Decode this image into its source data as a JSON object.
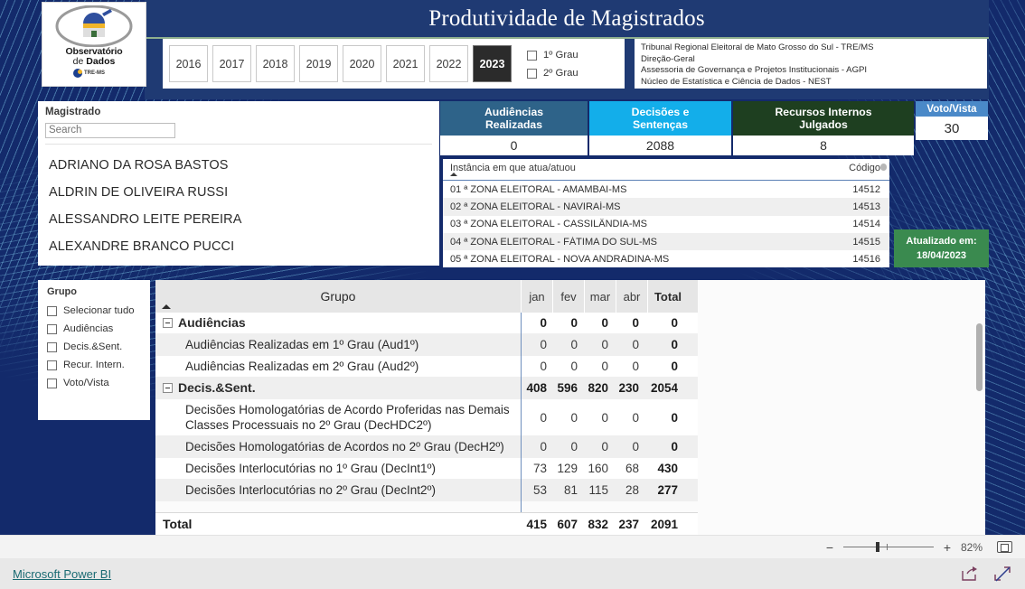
{
  "report": {
    "title": "Produtividade de Magistrados",
    "logo": {
      "name": "observatorio-de-dados-logo",
      "line1": "Observatório",
      "line2_light": "de ",
      "line2_bold": "Dados",
      "badge_text": "TRE-MS"
    },
    "institution_lines": [
      "Tribunal Regional Eleitoral de Mato Grosso do Sul - TRE/MS",
      "Direção-Geral",
      "Assessoria de Governança e Projetos Institucionais - AGPI",
      "Núcleo de Estatística e Ciência de Dados - NEST"
    ],
    "updated": {
      "label": "Atualizado em:",
      "date": "18/04/2023"
    },
    "colors": {
      "canvas_bg": "#132A6B",
      "header_bg": "#1F3A73",
      "kpi_audiencias": "#2E6389",
      "kpi_decisoes": "#13AEEA",
      "kpi_recursos": "#1E3F20",
      "kpi_voto": "#4A89C8",
      "updated_badge": "#3A8A4F",
      "link": "#1A6B73"
    }
  },
  "year_slicer": {
    "name": "year-slicer",
    "years": [
      "2016",
      "2017",
      "2018",
      "2019",
      "2020",
      "2021",
      "2022",
      "2023"
    ],
    "selected": "2023"
  },
  "grau_slicer": {
    "name": "grau-slicer",
    "options": [
      {
        "label": "1º Grau",
        "checked": false
      },
      {
        "label": "2º Grau",
        "checked": false
      }
    ]
  },
  "magistrado_slicer": {
    "title": "Magistrado",
    "search_placeholder": "Search",
    "search_value": "",
    "items": [
      "ADRIANO DA ROSA BASTOS",
      "ALDRIN DE OLIVEIRA RUSSI",
      "ALESSANDRO LEITE PEREIRA",
      "ALEXANDRE BRANCO PUCCI"
    ]
  },
  "kpis": [
    {
      "title_line1": "Audiências",
      "title_line2": "Realizadas",
      "value": "0"
    },
    {
      "title_line1": "Decisões e",
      "title_line2": "Sentenças",
      "value": "2088"
    },
    {
      "title_line1": "Recursos Internos",
      "title_line2": "Julgados",
      "value": "8"
    },
    {
      "title_line1": "Voto/Vista",
      "title_line2": "",
      "value": "30"
    }
  ],
  "instancia_table": {
    "columns": [
      "Instância em que atua/atuou",
      "Código"
    ],
    "rows": [
      {
        "nome": "01 ª ZONA ELEITORAL - AMAMBAI-MS",
        "codigo": "14512"
      },
      {
        "nome": "02 ª ZONA ELEITORAL - NAVIRAÍ-MS",
        "codigo": "14513"
      },
      {
        "nome": "03 ª ZONA ELEITORAL - CASSILÂNDIA-MS",
        "codigo": "14514"
      },
      {
        "nome": "04 ª ZONA ELEITORAL - FÁTIMA DO SUL-MS",
        "codigo": "14515"
      },
      {
        "nome": "05 ª ZONA ELEITORAL - NOVA ANDRADINA-MS",
        "codigo": "14516"
      }
    ]
  },
  "grupo_slicer": {
    "title": "Grupo",
    "options": [
      {
        "label": "Selecionar tudo",
        "checked": false
      },
      {
        "label": "Audiências",
        "checked": false
      },
      {
        "label": "Decis.&Sent.",
        "checked": false
      },
      {
        "label": "Recur. Intern.",
        "checked": false
      },
      {
        "label": "Voto/Vista",
        "checked": false
      }
    ]
  },
  "matrix": {
    "columns": [
      "Grupo",
      "jan",
      "fev",
      "mar",
      "abr",
      "Total"
    ],
    "rows": [
      {
        "label": "Audiências",
        "type": "group",
        "expanded": true,
        "values": [
          "0",
          "0",
          "0",
          "0"
        ],
        "total": "0"
      },
      {
        "label": "Audiências Realizadas em 1º Grau (Aud1º)",
        "type": "child",
        "values": [
          "0",
          "0",
          "0",
          "0"
        ],
        "total": "0"
      },
      {
        "label": "Audiências Realizadas em 2º Grau (Aud2º)",
        "type": "child",
        "values": [
          "0",
          "0",
          "0",
          "0"
        ],
        "total": "0"
      },
      {
        "label": "Decis.&Sent.",
        "type": "group",
        "expanded": true,
        "values": [
          "408",
          "596",
          "820",
          "230"
        ],
        "total": "2054"
      },
      {
        "label": "Decisões Homologatórias de Acordo Proferidas nas Demais Classes Processuais no 2º Grau (DecHDC2º)",
        "type": "child",
        "values": [
          "0",
          "0",
          "0",
          "0"
        ],
        "total": "0"
      },
      {
        "label": "Decisões Homologatórias de Acordos no 2º Grau (DecH2º)",
        "type": "child",
        "values": [
          "0",
          "0",
          "0",
          "0"
        ],
        "total": "0"
      },
      {
        "label": "Decisões Interlocutórias no 1º Grau (DecInt1º)",
        "type": "child",
        "values": [
          "73",
          "129",
          "160",
          "68"
        ],
        "total": "430"
      },
      {
        "label": "Decisões Interlocutórias no 2º Grau (DecInt2º)",
        "type": "child",
        "values": [
          "53",
          "81",
          "115",
          "28"
        ],
        "total": "277"
      }
    ],
    "total_row": {
      "label": "Total",
      "values": [
        "415",
        "607",
        "832",
        "237"
      ],
      "total": "2091"
    }
  },
  "statusbar": {
    "zoom_out": "−",
    "zoom_in": "+",
    "zoom_level": "82%",
    "fit_icon": "fit-to-page-icon"
  },
  "footer": {
    "link_text": "Microsoft Power BI",
    "share_icon": "share-icon",
    "fullscreen_icon": "fullscreen-icon"
  }
}
